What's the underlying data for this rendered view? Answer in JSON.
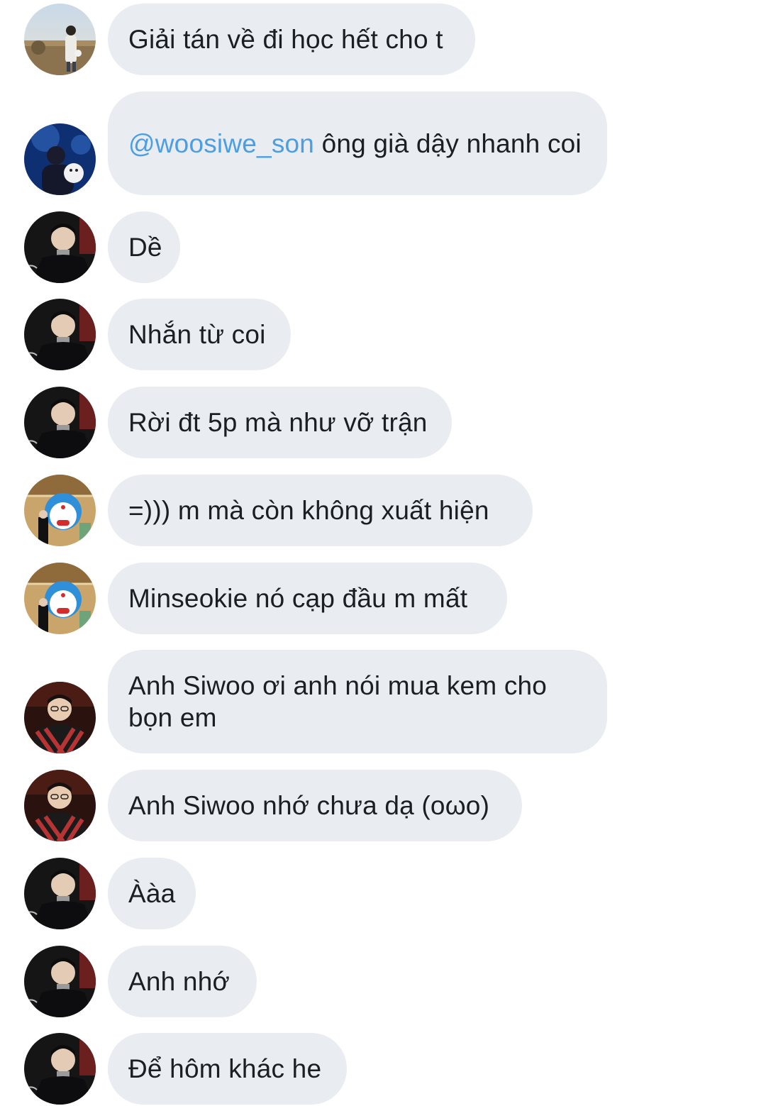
{
  "conversation": {
    "messages": [
      {
        "avatar": "avatar-user-field-photo",
        "text": "Giải tán về đi học hết cho t"
      },
      {
        "avatar": "avatar-user-blue-night-photo",
        "mention": "@woosiwe_son",
        "text": " ông già dậy nhanh coi"
      },
      {
        "avatar": "avatar-user-dark-coat",
        "text": "Dề"
      },
      {
        "avatar": "avatar-user-dark-coat",
        "text": "Nhắn từ coi"
      },
      {
        "avatar": "avatar-user-dark-coat",
        "text": "Rời đt 5p mà như vỡ trận"
      },
      {
        "avatar": "avatar-user-cartoon-cat-background",
        "text": "=))) m mà còn không xuất hiện"
      },
      {
        "avatar": "avatar-user-cartoon-cat-background",
        "text": "Minseokie nó cạp đầu m mất"
      },
      {
        "avatar": "avatar-user-glasses-red-scarf",
        "text": "Anh Siwoo ơi anh nói mua kem cho bọn em"
      },
      {
        "avatar": "avatar-user-glasses-red-scarf",
        "text": "Anh Siwoo nhớ chưa dạ (oωo)"
      },
      {
        "avatar": "avatar-user-dark-coat",
        "text": "Ààa"
      },
      {
        "avatar": "avatar-user-dark-coat",
        "text": "Anh nhớ"
      },
      {
        "avatar": "avatar-user-dark-coat",
        "text": "Để hôm khác he"
      }
    ]
  },
  "colors": {
    "bubble_background": "#e9edf1",
    "text": "#1b1f23",
    "mention": "#4c9ee3",
    "page_background": "#ffffff"
  }
}
